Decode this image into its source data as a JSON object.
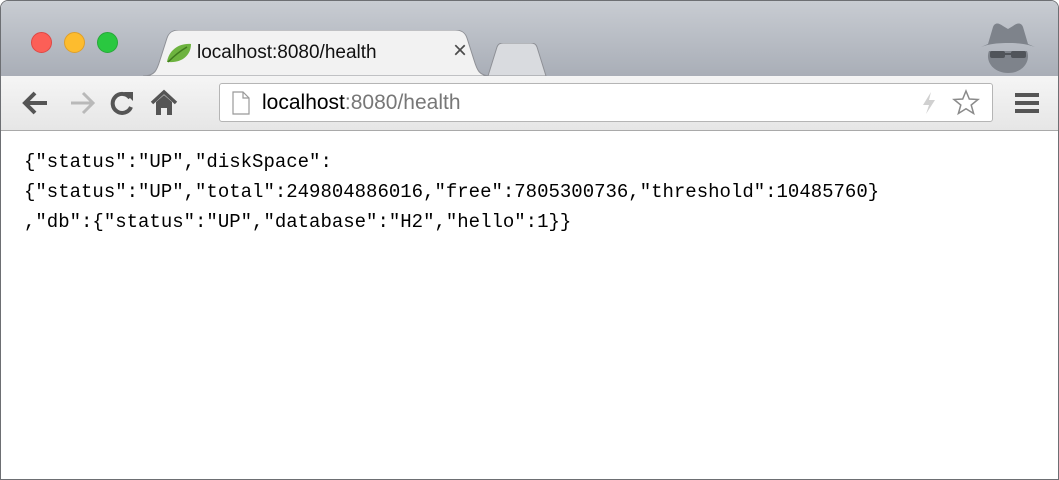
{
  "window": {
    "traffic_lights": [
      "close",
      "minimize",
      "zoom"
    ]
  },
  "tab": {
    "title": "localhost:8080/health",
    "favicon": "spring-leaf-icon",
    "close_glyph": "×"
  },
  "toolbar": {
    "back_icon": "back-arrow-icon",
    "forward_icon": "forward-arrow-icon",
    "reload_icon": "reload-icon",
    "home_icon": "home-icon",
    "url_host": "localhost",
    "url_rest": ":8080/health",
    "menu_icon": "hamburger-menu-icon"
  },
  "content": {
    "lines": [
      "{\"status\":\"UP\",\"diskSpace\":",
      "{\"status\":\"UP\",\"total\":249804886016,\"free\":7805300736,\"threshold\":10485760}",
      ",\"db\":{\"status\":\"UP\",\"database\":\"H2\",\"hello\":1}}"
    ]
  },
  "colors": {
    "titlebar": "#b8bcc4",
    "toolbar": "#ececec",
    "url_host": "#000000",
    "url_rest": "#777777",
    "spring_green": "#6db33f"
  }
}
